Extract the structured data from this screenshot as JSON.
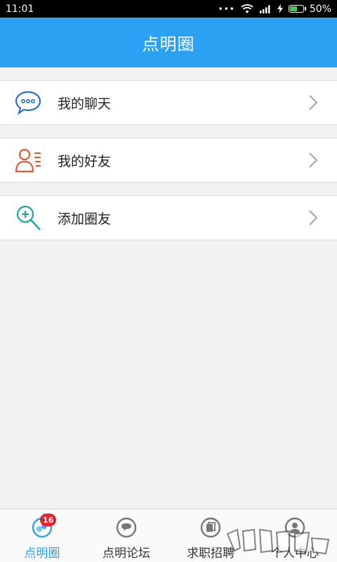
{
  "status_bar": {
    "time": "11:01",
    "dots": "•••",
    "battery": "50%",
    "battery_level": 0.5
  },
  "header": {
    "title": "点明圈"
  },
  "menu": [
    {
      "label": "我的聊天",
      "icon": "chat-bubble-icon",
      "color": "#2a6fc9"
    },
    {
      "label": "我的好友",
      "icon": "friends-list-icon",
      "color": "#e15a2f"
    },
    {
      "label": "添加圈友",
      "icon": "add-search-icon",
      "color": "#1aa39a"
    }
  ],
  "tabs": [
    {
      "label": "点明圈",
      "icon": "circle-tab-icon",
      "active": true,
      "badge": "16"
    },
    {
      "label": "点明论坛",
      "icon": "forum-tab-icon",
      "active": false
    },
    {
      "label": "求职招聘",
      "icon": "jobs-tab-icon",
      "active": false
    },
    {
      "label": "个人中心",
      "icon": "profile-tab-icon",
      "active": false
    }
  ],
  "colors": {
    "accent": "#2aa1f3",
    "badge": "#e8212b"
  }
}
